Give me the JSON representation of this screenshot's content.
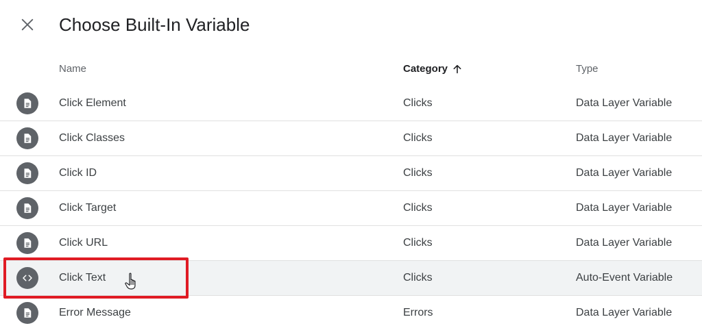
{
  "dialog": {
    "title": "Choose Built-In Variable",
    "close_icon": "close-icon"
  },
  "table": {
    "columns": {
      "name": "Name",
      "category": "Category",
      "type": "Type"
    },
    "sort": {
      "column": "Category",
      "direction": "ascending",
      "icon": "arrow-up-icon"
    },
    "rows": [
      {
        "name": "Click Element",
        "category": "Clicks",
        "type": "Data Layer Variable",
        "icon": "document-icon"
      },
      {
        "name": "Click Classes",
        "category": "Clicks",
        "type": "Data Layer Variable",
        "icon": "document-icon"
      },
      {
        "name": "Click ID",
        "category": "Clicks",
        "type": "Data Layer Variable",
        "icon": "document-icon"
      },
      {
        "name": "Click Target",
        "category": "Clicks",
        "type": "Data Layer Variable",
        "icon": "document-icon"
      },
      {
        "name": "Click URL",
        "category": "Clicks",
        "type": "Data Layer Variable",
        "icon": "document-icon"
      },
      {
        "name": "Click Text",
        "category": "Clicks",
        "type": "Auto-Event Variable",
        "icon": "code-icon"
      },
      {
        "name": "Error Message",
        "category": "Errors",
        "type": "Data Layer Variable",
        "icon": "document-icon"
      }
    ]
  },
  "colors": {
    "icon_bg": "#5f6368",
    "hover_row": "#f1f3f4",
    "highlight": "#e01b24"
  }
}
